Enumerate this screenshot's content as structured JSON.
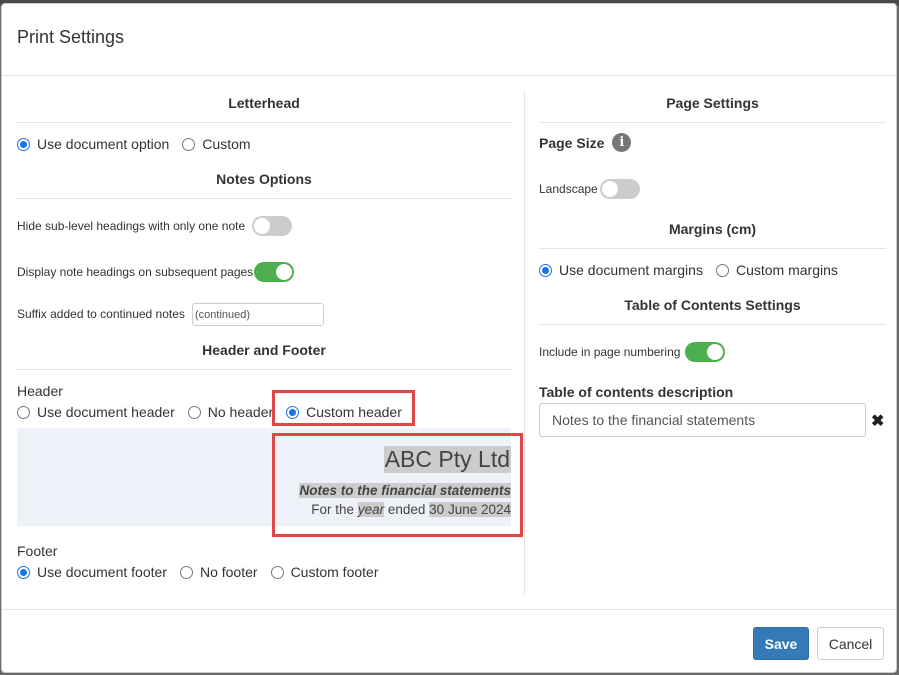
{
  "dialog": {
    "title": "Print Settings"
  },
  "letterhead": {
    "title": "Letterhead",
    "options": [
      "Use document option",
      "Custom"
    ],
    "selected": "Use document option"
  },
  "notes_options": {
    "title": "Notes Options",
    "hide_sub_level_label": "Hide sub-level headings with only one note",
    "hide_sub_level_on": false,
    "display_note_headings_label": "Display note headings on subsequent pages",
    "display_note_headings_on": true,
    "suffix_label": "Suffix added to continued notes",
    "suffix_value": "(continued)"
  },
  "header_footer": {
    "title": "Header and Footer",
    "header_label": "Header",
    "header_options": [
      "Use document header",
      "No header",
      "Custom header"
    ],
    "header_selected": "Custom header",
    "preview": {
      "company": "ABC Pty Ltd",
      "notes_title": "Notes to the financial statements",
      "period_prefix": "For the",
      "period_word": "year",
      "period_mid": "ended",
      "period_date": "30 June 2024"
    },
    "footer_label": "Footer",
    "footer_options": [
      "Use document footer",
      "No footer",
      "Custom footer"
    ],
    "footer_selected": "Use document footer"
  },
  "page_settings": {
    "title": "Page Settings",
    "page_size_label": "Page Size",
    "info_icon": "i",
    "landscape_label": "Landscape",
    "landscape_on": false
  },
  "margins": {
    "title": "Margins (cm)",
    "options": [
      "Use document margins",
      "Custom margins"
    ],
    "selected": "Use document margins"
  },
  "toc": {
    "title": "Table of Contents Settings",
    "include_label": "Include in page numbering",
    "include_on": true,
    "description_label": "Table of contents description",
    "description_value": "Notes to the financial statements",
    "clear_icon": "✖"
  },
  "buttons": {
    "save": "Save",
    "cancel": "Cancel"
  },
  "colors": {
    "accent": "#1a73e8",
    "toggle_on": "#4cae4c",
    "highlight": "#e04848",
    "save_button": "#337ab7"
  }
}
